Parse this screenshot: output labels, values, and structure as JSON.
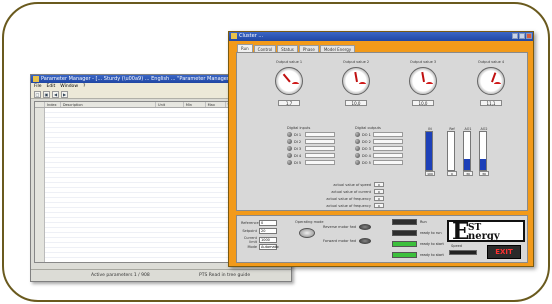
{
  "parameter_manager": {
    "title": "Parameter Manager - [... Sturdy (\\u00a9) ... English ... \"Parameter Manager\" ... Version 01 ...]",
    "menu": [
      "File",
      "Edit",
      "Window",
      "?"
    ],
    "toolbar_icons": [
      "open-icon",
      "save-icon",
      "arrow-left-icon",
      "arrow-right-icon"
    ],
    "columns": [
      "",
      "Index",
      "Description",
      "Unit",
      "Min",
      "Max",
      "Value",
      "Protection"
    ],
    "status": {
      "left": "Active parameters     1 / 908",
      "right": "PTS   Read in tree guide"
    }
  },
  "cluster_window": {
    "title": "Cluster ...",
    "tabs": [
      "Run",
      "Control",
      "Status",
      "Phase",
      "Model Energy"
    ],
    "gauges": [
      {
        "label": "Output value 1",
        "value": "1,7"
      },
      {
        "label": "Output value 2",
        "value": "10,0"
      },
      {
        "label": "Output value 3",
        "value": "10,0"
      },
      {
        "label": "Output value 4",
        "value": "11,1"
      }
    ],
    "lamp_groups": [
      {
        "title": "Digital inputs",
        "labels": [
          "DI 1",
          "DI 2",
          "DI 3",
          "DI 4",
          "DI 5"
        ]
      },
      {
        "title": "Digital outputs",
        "labels": [
          "DO 1",
          "DO 2",
          "DO 3",
          "DO 4",
          "DO 5"
        ]
      }
    ],
    "bars": [
      {
        "label": "IN",
        "value": "100",
        "fraction": 1.0
      },
      {
        "label": "Ref",
        "value": "0",
        "fraction": 0.0
      },
      {
        "label": "AO1",
        "value": "30",
        "fraction": 0.3
      },
      {
        "label": "AO2",
        "value": "30",
        "fraction": 0.3
      }
    ],
    "info_rows": [
      {
        "label": "actual value of speed",
        "value": "0"
      },
      {
        "label": "actual value of current",
        "value": "0"
      },
      {
        "label": "actual value of frequency",
        "value": "0"
      },
      {
        "label": "actual value of frequency",
        "value": "0"
      }
    ],
    "controls": [
      {
        "label": "Reference",
        "value": "0"
      },
      {
        "label": "Setpoint",
        "value": "20"
      },
      {
        "label": "Current limit",
        "value": "1000"
      },
      {
        "label": "Mode",
        "value": "Automatic"
      }
    ],
    "mode_knob_label": "Operating mode",
    "buttons": [
      {
        "label": "Reverse motor fwd"
      },
      {
        "label": "Forward motor fwd"
      }
    ],
    "indicators": [
      {
        "label": "Run",
        "color": "#2e2e2e"
      },
      {
        "label": "ready to run",
        "color": "#2e2e2e"
      },
      {
        "label": "ready to start",
        "color": "#3cc03c"
      },
      {
        "label": "ready to start",
        "color": "#3cc03c"
      }
    ],
    "logo": {
      "big": "E",
      "top": "ST",
      "bottom": "nergy"
    },
    "speed_label": "Speed",
    "exit_label": "EXIT"
  }
}
